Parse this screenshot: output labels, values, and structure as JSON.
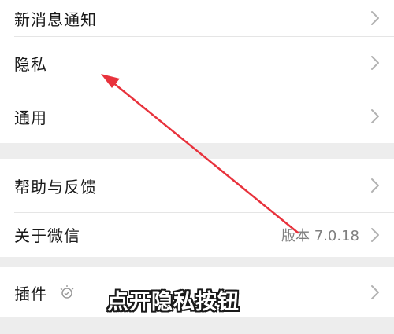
{
  "settings": {
    "group1": [
      {
        "id": "new-message-notify",
        "label": "新消息通知"
      },
      {
        "id": "privacy",
        "label": "隐私"
      },
      {
        "id": "general",
        "label": "通用"
      }
    ],
    "group2": [
      {
        "id": "help-feedback",
        "label": "帮助与反馈"
      },
      {
        "id": "about-wechat",
        "label": "关于微信",
        "value": "版本 7.0.18"
      }
    ],
    "group3": [
      {
        "id": "plugins",
        "label": "插件",
        "icon": "plugin-bulb-icon"
      }
    ]
  },
  "annotation": {
    "caption": "点开隐私按钮",
    "arrow_color": "#e8323c"
  },
  "colors": {
    "background": "#ededed",
    "row": "#ffffff",
    "text": "#191919",
    "secondary_text": "#7f7f7f",
    "chevron": "#b2b2b2"
  }
}
